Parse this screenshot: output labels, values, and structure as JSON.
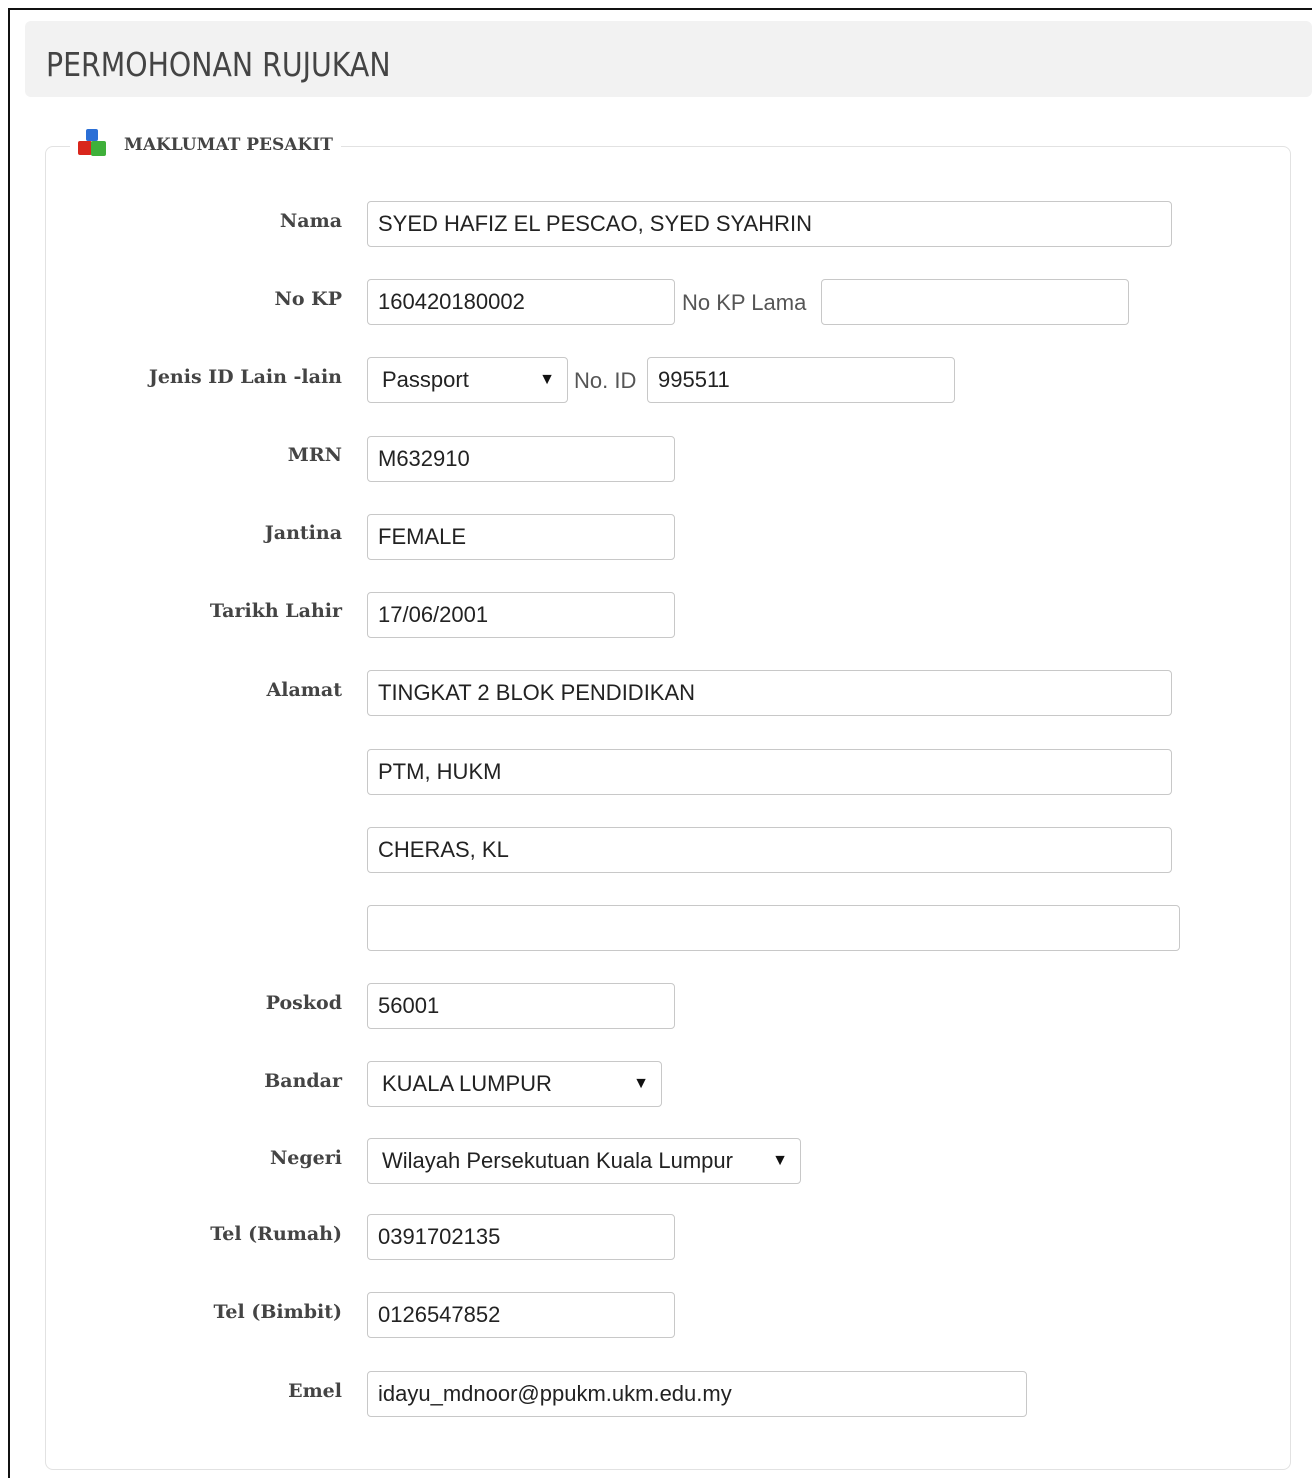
{
  "page": {
    "title": "PERMOHONAN RUJUKAN"
  },
  "section": {
    "legend": "MAKLUMAT PESAKIT",
    "icon": "blocks-icon"
  },
  "fields": {
    "nama": {
      "label": "Nama",
      "value": "SYED HAFIZ EL PESCAO, SYED SYAHRIN"
    },
    "no_kp": {
      "label": "No KP",
      "value": "160420180002"
    },
    "no_kp_lama": {
      "label": "No KP Lama",
      "value": ""
    },
    "jenis_id": {
      "label": "Jenis ID Lain -lain",
      "selected": "Passport"
    },
    "no_id": {
      "label": "No. ID",
      "value": "995511"
    },
    "mrn": {
      "label": "MRN",
      "value": "M632910"
    },
    "jantina": {
      "label": "Jantina",
      "value": "FEMALE"
    },
    "tarikh_lahir": {
      "label": "Tarikh Lahir",
      "value": "17/06/2001"
    },
    "alamat": {
      "label": "Alamat",
      "lines": [
        "TINGKAT 2 BLOK PENDIDIKAN",
        "PTM, HUKM",
        "CHERAS, KL",
        ""
      ]
    },
    "poskod": {
      "label": "Poskod",
      "value": "56001"
    },
    "bandar": {
      "label": "Bandar",
      "selected": "KUALA LUMPUR"
    },
    "negeri": {
      "label": "Negeri",
      "selected": "Wilayah Persekutuan Kuala Lumpur"
    },
    "tel_rumah": {
      "label": "Tel (Rumah)",
      "value": "0391702135"
    },
    "tel_bimbit": {
      "label": "Tel (Bimbit)",
      "value": "0126547852"
    },
    "emel": {
      "label": "Emel",
      "value": "idayu_mdnoor@ppukm.ukm.edu.my"
    }
  },
  "dropdown_arrow": "▼"
}
